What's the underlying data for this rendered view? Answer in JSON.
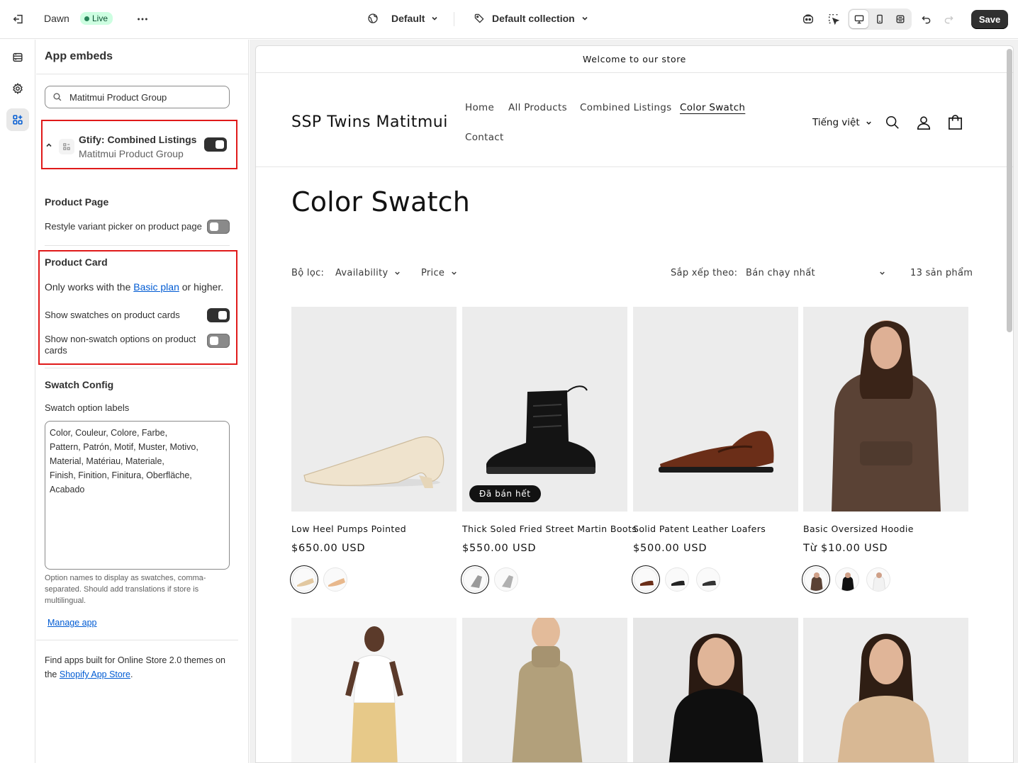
{
  "topbar": {
    "theme_name": "Dawn",
    "live_label": "Live",
    "template_selector": "Default",
    "collection_selector": "Default collection",
    "save_label": "Save"
  },
  "sidebar": {
    "title": "App embeds",
    "search_value": "Matitmui Product Group",
    "embed": {
      "title": "Gtify: Combined Listings",
      "subtitle": "Matitmui Product Group",
      "enabled": true
    },
    "product_page": {
      "title": "Product Page",
      "restyle_label": "Restyle variant picker on product page",
      "restyle_enabled": false
    },
    "product_card": {
      "title": "Product Card",
      "plan_prefix": "Only works with the",
      "plan_link": "Basic plan",
      "plan_suffix": "or higher.",
      "show_swatches_label": "Show swatches on product cards",
      "show_swatches_enabled": true,
      "show_non_swatch_label": "Show non-swatch options on product cards",
      "show_non_swatch_enabled": false
    },
    "swatch_config": {
      "title": "Swatch Config",
      "labels_title": "Swatch option labels",
      "labels_value": "Color, Couleur, Colore, Farbe,\nPattern, Patrón, Motif, Muster, Motivo,\nMaterial, Matériau, Materiale,\nFinish, Finition, Finitura, Oberfläche,\nAcabado",
      "help_text": "Option names to display as swatches, comma-separated. Should add translations if store is multilingual.",
      "manage_app": "Manage app"
    },
    "footer": {
      "prefix": "Find apps built for Online Store 2.0 themes on the",
      "link": "Shopify App Store",
      "suffix": "."
    }
  },
  "store": {
    "announcement": "Welcome to our store",
    "brand": "SSP Twins Matitmui",
    "nav": [
      "Home",
      "All Products",
      "Combined Listings",
      "Color Swatch",
      "Contact"
    ],
    "language": "Tiếng việt",
    "page_title": "Color Swatch",
    "filter_label": "Bộ lọc:",
    "filter_availability": "Availability",
    "filter_price": "Price",
    "sort_label": "Sắp xếp theo:",
    "sort_value": "Bán chạy nhất",
    "count": "13 sản phẩm",
    "products": [
      {
        "name": "Low Heel Pumps Pointed",
        "price": "$650.00 USD",
        "swatches": 2
      },
      {
        "name": "Thick Soled Fried Street Martin Boots",
        "price": "$550.00 USD",
        "swatches": 2,
        "badge": "Đã bán hết"
      },
      {
        "name": "Solid Patent Leather Loafers",
        "price": "$500.00 USD",
        "swatches": 3
      },
      {
        "name": "Basic Oversized Hoodie",
        "price": "Từ $10.00 USD",
        "swatches": 3
      }
    ]
  },
  "colors": {
    "highlight": "#e01a1a",
    "live_bg": "#cdfee1",
    "link": "#005bd3",
    "hoodie": "#5a4235",
    "pump": "#efe3cd",
    "loafer": "#6b2e18"
  }
}
